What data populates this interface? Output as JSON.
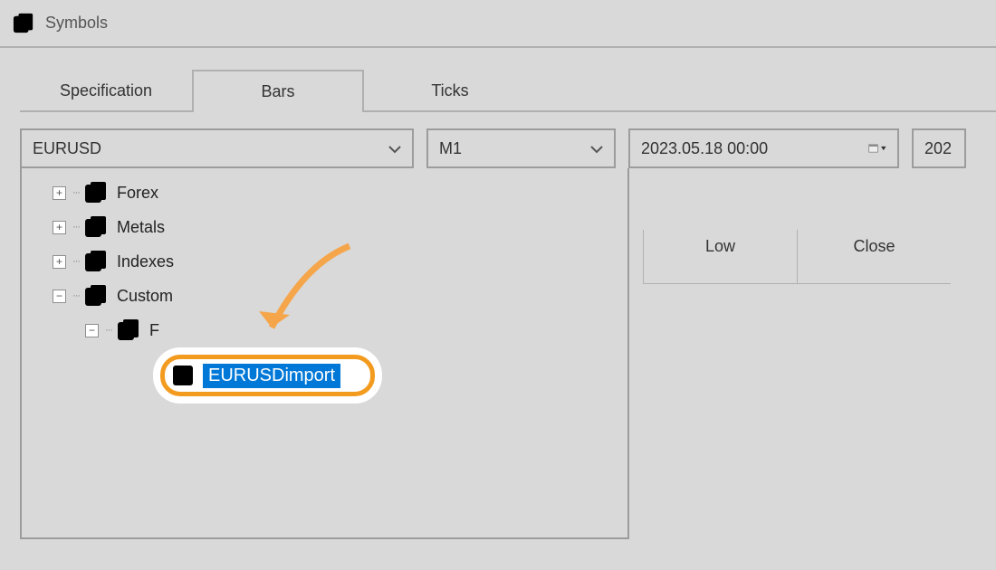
{
  "window": {
    "title": "Symbols"
  },
  "tabs": [
    {
      "label": "Specification",
      "active": false
    },
    {
      "label": "Bars",
      "active": true
    },
    {
      "label": "Ticks",
      "active": false
    }
  ],
  "toolbar": {
    "symbol_value": "EURUSD",
    "timeframe_value": "M1",
    "date_from": "2023.05.18 00:00",
    "date_to_partial": "202"
  },
  "tree": {
    "items": [
      {
        "label": "Forex",
        "exp": "+",
        "indent": 0
      },
      {
        "label": "Metals",
        "exp": "+",
        "indent": 0
      },
      {
        "label": "Indexes",
        "exp": "+",
        "indent": 0
      },
      {
        "label": "Custom",
        "exp": "−",
        "indent": 0
      },
      {
        "label": "F",
        "exp": "−",
        "indent": 1
      }
    ],
    "selected_label": "EURUSDimport"
  },
  "table": {
    "headers": {
      "low": "Low",
      "close": "Close"
    }
  }
}
